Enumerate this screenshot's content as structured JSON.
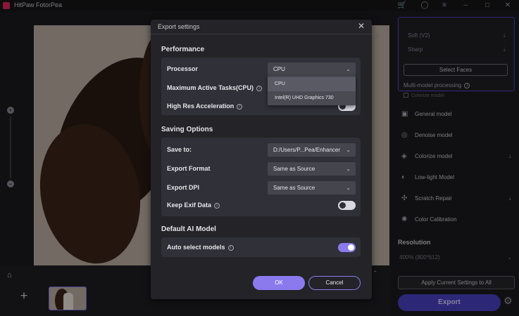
{
  "app": {
    "title": "HitPaw FotorPea"
  },
  "right_panel": {
    "face_options": [
      {
        "label": "Soft (V2)"
      },
      {
        "label": "Sharp"
      }
    ],
    "select_faces": "Select Faces",
    "multi_model": "Multi-model processing",
    "colorize_model": "Colorize model",
    "models": [
      {
        "label": "General model",
        "icon": "image-icon"
      },
      {
        "label": "Denoise model",
        "icon": "denoise-icon"
      },
      {
        "label": "Colorize model",
        "icon": "colorize-icon"
      },
      {
        "label": "Low-light Model",
        "icon": "lowlight-icon"
      },
      {
        "label": "Scratch Repair",
        "icon": "scratch-icon"
      },
      {
        "label": "Color Calibration",
        "icon": "calibration-icon"
      }
    ],
    "resolution_label": "Resolution",
    "resolution_value": "400% (800*612)",
    "apply_button": "Apply Current Settings to All",
    "export_button": "Export"
  },
  "dialog": {
    "title": "Export settings",
    "performance": {
      "section_title": "Performance",
      "processor_label": "Processor",
      "processor_value": "CPU",
      "max_tasks_label": "Maximum Active Tasks(CPU)",
      "high_res_label": "High Res Acceleration",
      "processor_options": [
        "CPU",
        "Intel(R) UHD Graphics 730"
      ]
    },
    "saving": {
      "section_title": "Saving Options",
      "save_to_label": "Save to:",
      "save_to_value": "D:/Users/P...Pea/Enhancer",
      "format_label": "Export Format",
      "format_value": "Same as Source",
      "dpi_label": "Export DPI",
      "dpi_value": "Same as Source",
      "exif_label": "Keep Exif Data",
      "exif_enabled": false
    },
    "ai_model": {
      "section_title": "Default AI Model",
      "auto_label": "Auto select models",
      "auto_enabled": true
    },
    "ok_button": "OK",
    "cancel_button": "Cancel"
  }
}
